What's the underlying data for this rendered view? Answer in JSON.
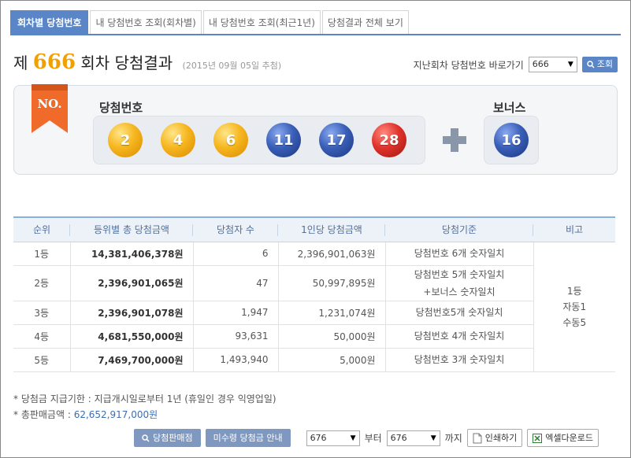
{
  "tabs": [
    {
      "label": "회차별 당첨번호"
    },
    {
      "label": "내 당첨번호 조회(회차별)"
    },
    {
      "label": "내 당첨번호 조회(최근1년)"
    },
    {
      "label": "당첨결과 전체 보기"
    }
  ],
  "header": {
    "prefix": "제",
    "round": "666",
    "suffix": "회차 당첨결과",
    "date": "(2015년 09월 05일 추첨)",
    "goto_label": "지난회차 당첨번호 바로가기",
    "goto_value": "666",
    "search_label": "조회"
  },
  "draw": {
    "badge_text": "NO.",
    "main_label": "당첨번호",
    "bonus_label": "보너스",
    "numbers": [
      "2",
      "4",
      "6",
      "11",
      "17",
      "28"
    ],
    "number_colors": [
      "yellow",
      "yellow",
      "yellow",
      "blue",
      "blue",
      "red"
    ],
    "bonus": "16",
    "bonus_color": "blue"
  },
  "table": {
    "headers": [
      "순위",
      "등위별 총 당첨금액",
      "당첨자 수",
      "1인당 당첨금액",
      "당첨기준",
      "비고"
    ],
    "rows": [
      {
        "rank": "1등",
        "total": "14,381,406,378원",
        "winners": "6",
        "per": "2,396,901,063원",
        "crit1": "당첨번호 6개 숫자일치",
        "crit2": ""
      },
      {
        "rank": "2등",
        "total": "2,396,901,065원",
        "winners": "47",
        "per": "50,997,895원",
        "crit1": "당첨번호 5개 숫자일치",
        "crit2": "+보너스 숫자일치"
      },
      {
        "rank": "3등",
        "total": "2,396,901,078원",
        "winners": "1,947",
        "per": "1,231,074원",
        "crit1": "당첨번호5개 숫자일치",
        "crit2": ""
      },
      {
        "rank": "4등",
        "total": "4,681,550,000원",
        "winners": "93,631",
        "per": "50,000원",
        "crit1": "당첨번호 4개 숫자일치",
        "crit2": ""
      },
      {
        "rank": "5등",
        "total": "7,469,700,000원",
        "winners": "1,493,940",
        "per": "5,000원",
        "crit1": "당첨번호 3개 숫자일치",
        "crit2": ""
      }
    ],
    "note_lines": [
      "1등",
      "자동1",
      "수동5"
    ]
  },
  "notes": {
    "line1": "* 당첨금 지급기한 : 지급개시일로부터 1년 (휴일인 경우 익영업일)",
    "line2_label": "* 총판매금액 : ",
    "line2_value": "62,652,917,000원"
  },
  "bottom": {
    "store_button": "당첨판매점",
    "unclaimed_button": "미수령 당첨금 안내",
    "from_value": "676",
    "from_label": "부터",
    "to_value": "676",
    "to_label": "까지",
    "print_button": "인쇄하기",
    "excel_button": "엑셀다운로드"
  },
  "colors": {
    "accent": "#5a86c8",
    "round": "#f0a000",
    "header_bg": "#edf2f9"
  }
}
